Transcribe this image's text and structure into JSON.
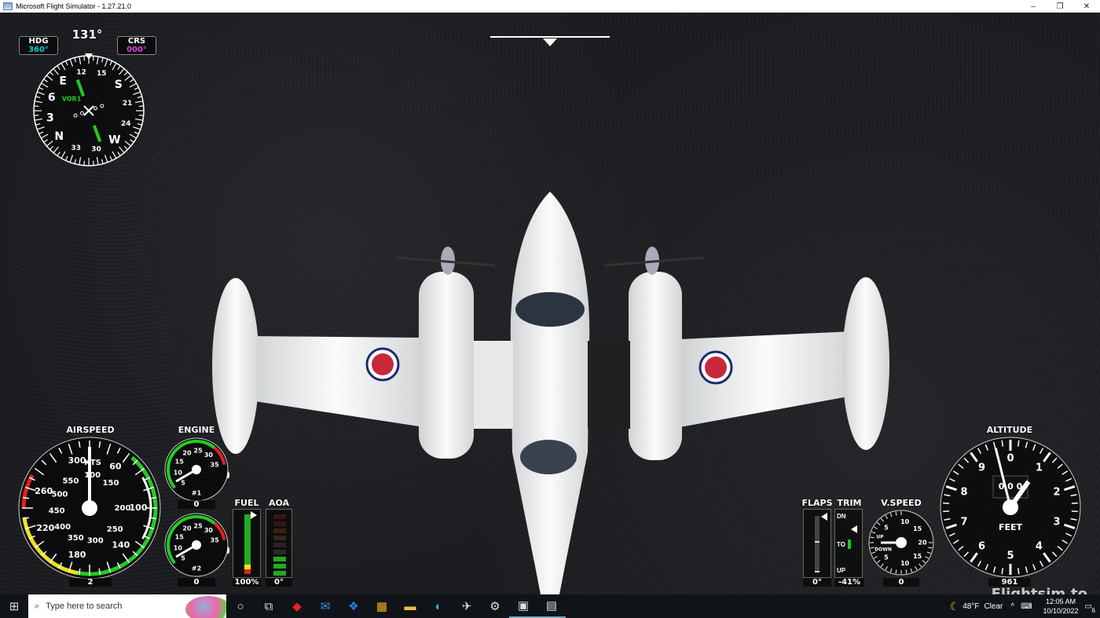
{
  "window": {
    "title": "Microsoft Flight Simulator - 1.27.21.0",
    "controls": [
      "–",
      "❐",
      "✕"
    ]
  },
  "compass": {
    "hdg_label": "HDG",
    "hdg_value": "360°",
    "heading_readout": "131°",
    "crs_label": "CRS",
    "crs_value": "000°",
    "nav_label": "VOR1",
    "card_labels": [
      "12",
      "15",
      "S",
      "21",
      "24",
      "W",
      "30",
      "33",
      "N",
      "3",
      "6",
      "E"
    ]
  },
  "airspeed": {
    "title": "AIRSPEED",
    "unit": "KTS",
    "outer_scale": [
      "60",
      "100",
      "140",
      "180",
      "220",
      "260",
      "300"
    ],
    "inner_scale": [
      "100",
      "150",
      "200",
      "250",
      "300",
      "350",
      "400",
      "450",
      "500",
      "550"
    ],
    "readout": "2"
  },
  "engine": {
    "title": "ENGINE",
    "ticks": [
      "5",
      "10",
      "15",
      "20",
      "25",
      "30",
      "35"
    ],
    "eng1_label": "#1",
    "eng2_label": "#2",
    "eng1_readout": "0",
    "eng2_readout": "0"
  },
  "fuel": {
    "title": "FUEL",
    "readout": "100%",
    "level": 1.0
  },
  "aoa": {
    "title": "AOA",
    "readout": "0°"
  },
  "flaps": {
    "title": "FLAPS",
    "readout": "0°"
  },
  "trim": {
    "title": "TRIM",
    "dn_label": "DN",
    "to_label": "TO",
    "up_label": "UP",
    "readout": "-41%"
  },
  "vspeed": {
    "title": "V.SPEED",
    "labels": [
      "5",
      "10",
      "15",
      "20",
      "15",
      "10",
      "5"
    ],
    "up_label": "UP",
    "down_label": "DOWN",
    "readout": "0"
  },
  "altitude": {
    "title": "ALTITUDE",
    "digits": [
      "0",
      "1",
      "2",
      "3",
      "4",
      "5",
      "6",
      "7",
      "8",
      "9"
    ],
    "unit": "FEET",
    "drum": "0 0 0",
    "readout": "961"
  },
  "taskbar": {
    "search_placeholder": "Type here to search",
    "weather_temp": "48°F",
    "weather_text": "Clear",
    "time": "12:05 AM",
    "date": "10/10/2022",
    "notification_count": "6"
  },
  "watermark": "Flightsim.to",
  "colors": {
    "green": "#22cc22",
    "red": "#e02020",
    "yellow": "#f0e020",
    "cyan": "#00d0d0",
    "magenta": "#e040e0"
  }
}
